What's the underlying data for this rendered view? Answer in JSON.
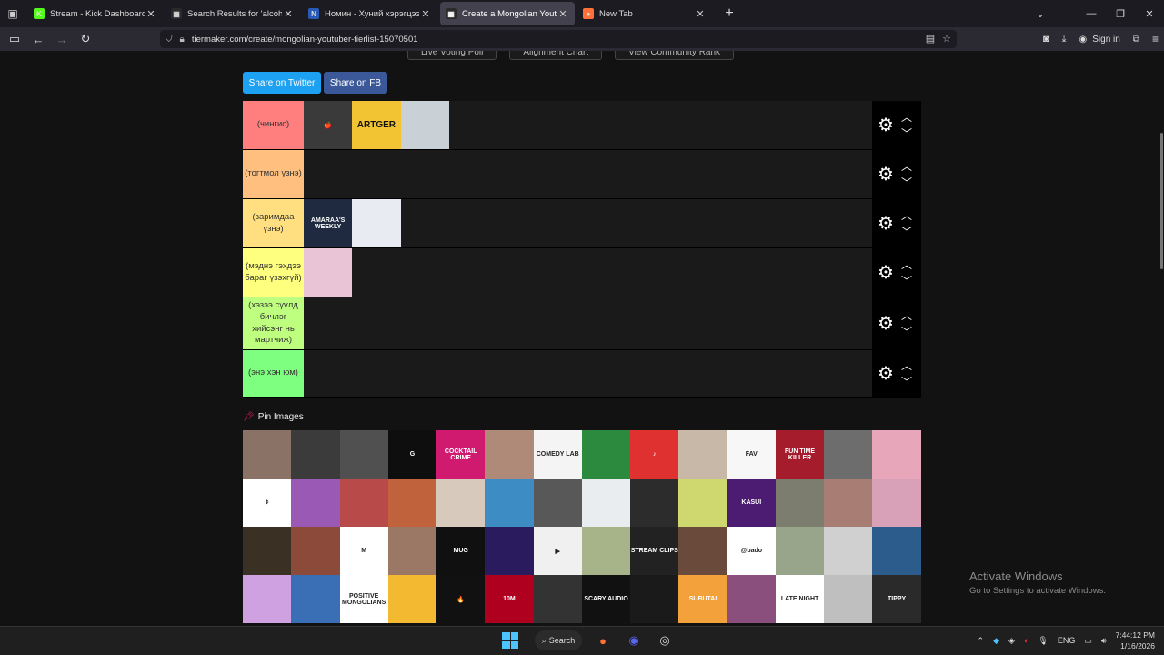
{
  "browser": {
    "tabs": [
      {
        "title": "Stream - Kick Dashboard",
        "favicon_color": "#53fc18",
        "favicon_glyph": "K",
        "active": false
      },
      {
        "title": "Search Results for 'alcohol' - Tie",
        "favicon_color": "#2a2a2a",
        "favicon_glyph": "▦",
        "active": false
      },
      {
        "title": "Номин - Хуний хэрэгцээ цем",
        "favicon_color": "#2a5ab8",
        "favicon_glyph": "Ν",
        "active": false
      },
      {
        "title": "Create a Mongolian Youtuber Ti",
        "favicon_color": "#2a2a2a",
        "favicon_glyph": "▦",
        "active": true
      },
      {
        "title": "New Tab",
        "favicon_color": "#ff7139",
        "favicon_glyph": "●",
        "active": false
      }
    ],
    "url": "tiermaker.com/create/mongolian-youtuber-tierlist-15070501",
    "sign_in": "Sign in"
  },
  "page": {
    "top_buttons": [
      "Live Voting Poll",
      "Alignment Chart",
      "View Community Rank"
    ],
    "share_twitter": "Share on Twitter",
    "share_fb": "Share on FB",
    "tiers": [
      {
        "label": "(чингис)",
        "color": "#ff7f7f",
        "items": [
          {
            "name": "apple-logo-image",
            "bg": "#3a3a3a",
            "text": "🍎"
          },
          {
            "name": "artger-logo-image",
            "bg": "#f2c434",
            "text": "ARTGER"
          },
          {
            "name": "person-birds-image",
            "bg": "#c9d0d6",
            "text": ""
          }
        ]
      },
      {
        "label": "(тогтмол үзнэ)",
        "color": "#ffbf7f",
        "items": []
      },
      {
        "label": "(заримдаа үзнэ)",
        "color": "#ffdf7f",
        "items": [
          {
            "name": "amaraas-weekly-image",
            "bg": "#1f2a40",
            "text": "AMARAA'S WEEKLY"
          },
          {
            "name": "globe-logo-image",
            "bg": "#e8ecf2",
            "text": ""
          }
        ]
      },
      {
        "label": "(мэднэ гэхдээ бараг үзэхгүй)",
        "color": "#ffff7f",
        "items": [
          {
            "name": "two-girls-podcast-image",
            "bg": "#e9c4d6",
            "text": ""
          }
        ]
      },
      {
        "label": "(хэзээ сүүлд бичлэг хийсэнг нь мартчиж)",
        "color": "#bfff7f",
        "items": []
      },
      {
        "label": "(энэ хэн юм)",
        "color": "#7fff7f",
        "items": []
      }
    ],
    "pin_images_label": "Pin Images",
    "pool": [
      {
        "bg": "#8a7266",
        "text": ""
      },
      {
        "bg": "#3b3b3b",
        "text": ""
      },
      {
        "bg": "#505050",
        "text": ""
      },
      {
        "bg": "#0e0e0e",
        "text": "G"
      },
      {
        "bg": "#d01a6f",
        "text": "COCKTAIL CRIME"
      },
      {
        "bg": "#b08a78",
        "text": ""
      },
      {
        "bg": "#f4f4f4",
        "text": "COMEDY LAB"
      },
      {
        "bg": "#2b8a3e",
        "text": ""
      },
      {
        "bg": "#e03131",
        "text": "♪"
      },
      {
        "bg": "#c8b8a8",
        "text": ""
      },
      {
        "bg": "#f7f7f7",
        "text": "FAV"
      },
      {
        "bg": "#a51d2d",
        "text": "FUN TIME KILLER"
      },
      {
        "bg": "#6d6d6d",
        "text": ""
      },
      {
        "bg": "#e7a6b9",
        "text": ""
      },
      {
        "bg": "#ffffff",
        "text": "⌽"
      },
      {
        "bg": "#9b59b6",
        "text": ""
      },
      {
        "bg": "#b84a4a",
        "text": ""
      },
      {
        "bg": "#c0623c",
        "text": ""
      },
      {
        "bg": "#d8c9bd",
        "text": ""
      },
      {
        "bg": "#3d8dc4",
        "text": ""
      },
      {
        "bg": "#585858",
        "text": ""
      },
      {
        "bg": "#e9edf0",
        "text": ""
      },
      {
        "bg": "#2c2c2c",
        "text": ""
      },
      {
        "bg": "#cfd86f",
        "text": ""
      },
      {
        "bg": "#4b1c72",
        "text": "KASUI"
      },
      {
        "bg": "#7c7c6f",
        "text": ""
      },
      {
        "bg": "#a87e74",
        "text": ""
      },
      {
        "bg": "#d9a1b8",
        "text": ""
      },
      {
        "bg": "#3a3024",
        "text": ""
      },
      {
        "bg": "#8b4a3a",
        "text": ""
      },
      {
        "bg": "#ffffff",
        "text": "M"
      },
      {
        "bg": "#9a7865",
        "text": ""
      },
      {
        "bg": "#101010",
        "text": "MUG"
      },
      {
        "bg": "#2a1a5e",
        "text": ""
      },
      {
        "bg": "#f0f0f0",
        "text": "▶"
      },
      {
        "bg": "#a7b48a",
        "text": ""
      },
      {
        "bg": "#222222",
        "text": "STREAM CLIPS"
      },
      {
        "bg": "#6a4a3a",
        "text": ""
      },
      {
        "bg": "#ffffff",
        "text": "@bado"
      },
      {
        "bg": "#99a58a",
        "text": ""
      },
      {
        "bg": "#d0d0d0",
        "text": ""
      },
      {
        "bg": "#2c5c8c",
        "text": ""
      },
      {
        "bg": "#cfa1e0",
        "text": ""
      },
      {
        "bg": "#3b6fb5",
        "text": ""
      },
      {
        "bg": "#ffffff",
        "text": "POSITIVE MONGOLIANS"
      },
      {
        "bg": "#f3b931",
        "text": ""
      },
      {
        "bg": "#111111",
        "text": "🔥"
      },
      {
        "bg": "#b00020",
        "text": "10M"
      },
      {
        "bg": "#333333",
        "text": ""
      },
      {
        "bg": "#111111",
        "text": "SCARY AUDIO"
      },
      {
        "bg": "#1a1a1a",
        "text": ""
      },
      {
        "bg": "#f3a13a",
        "text": "SUBUTAI"
      },
      {
        "bg": "#8a4f7d",
        "text": ""
      },
      {
        "bg": "#ffffff",
        "text": "LATE NIGHT"
      },
      {
        "bg": "#bfbfbf",
        "text": ""
      },
      {
        "bg": "#2a2a2a",
        "text": "TIPPY"
      }
    ],
    "activate_title": "Activate Windows",
    "activate_sub": "Go to Settings to activate Windows."
  },
  "taskbar": {
    "search_label": "Search",
    "language": "ENG",
    "time": "7:44:12 PM",
    "date": "1/16/2026"
  }
}
